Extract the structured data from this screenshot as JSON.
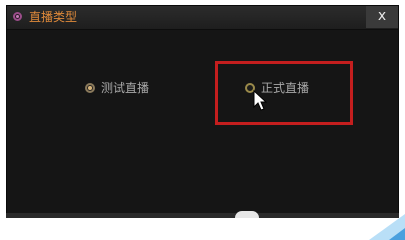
{
  "dialog": {
    "title": "直播类型",
    "close_label": "x"
  },
  "options": [
    {
      "label": "测试直播",
      "selected": true
    },
    {
      "label": "正式直播",
      "selected": false
    }
  ],
  "colors": {
    "title_text": "#e08a3a",
    "highlight": "#c41e1e",
    "background": "#151515"
  },
  "icons": {
    "app": "app-logo-icon",
    "close": "close-icon",
    "cursor": "mouse-cursor-icon"
  }
}
